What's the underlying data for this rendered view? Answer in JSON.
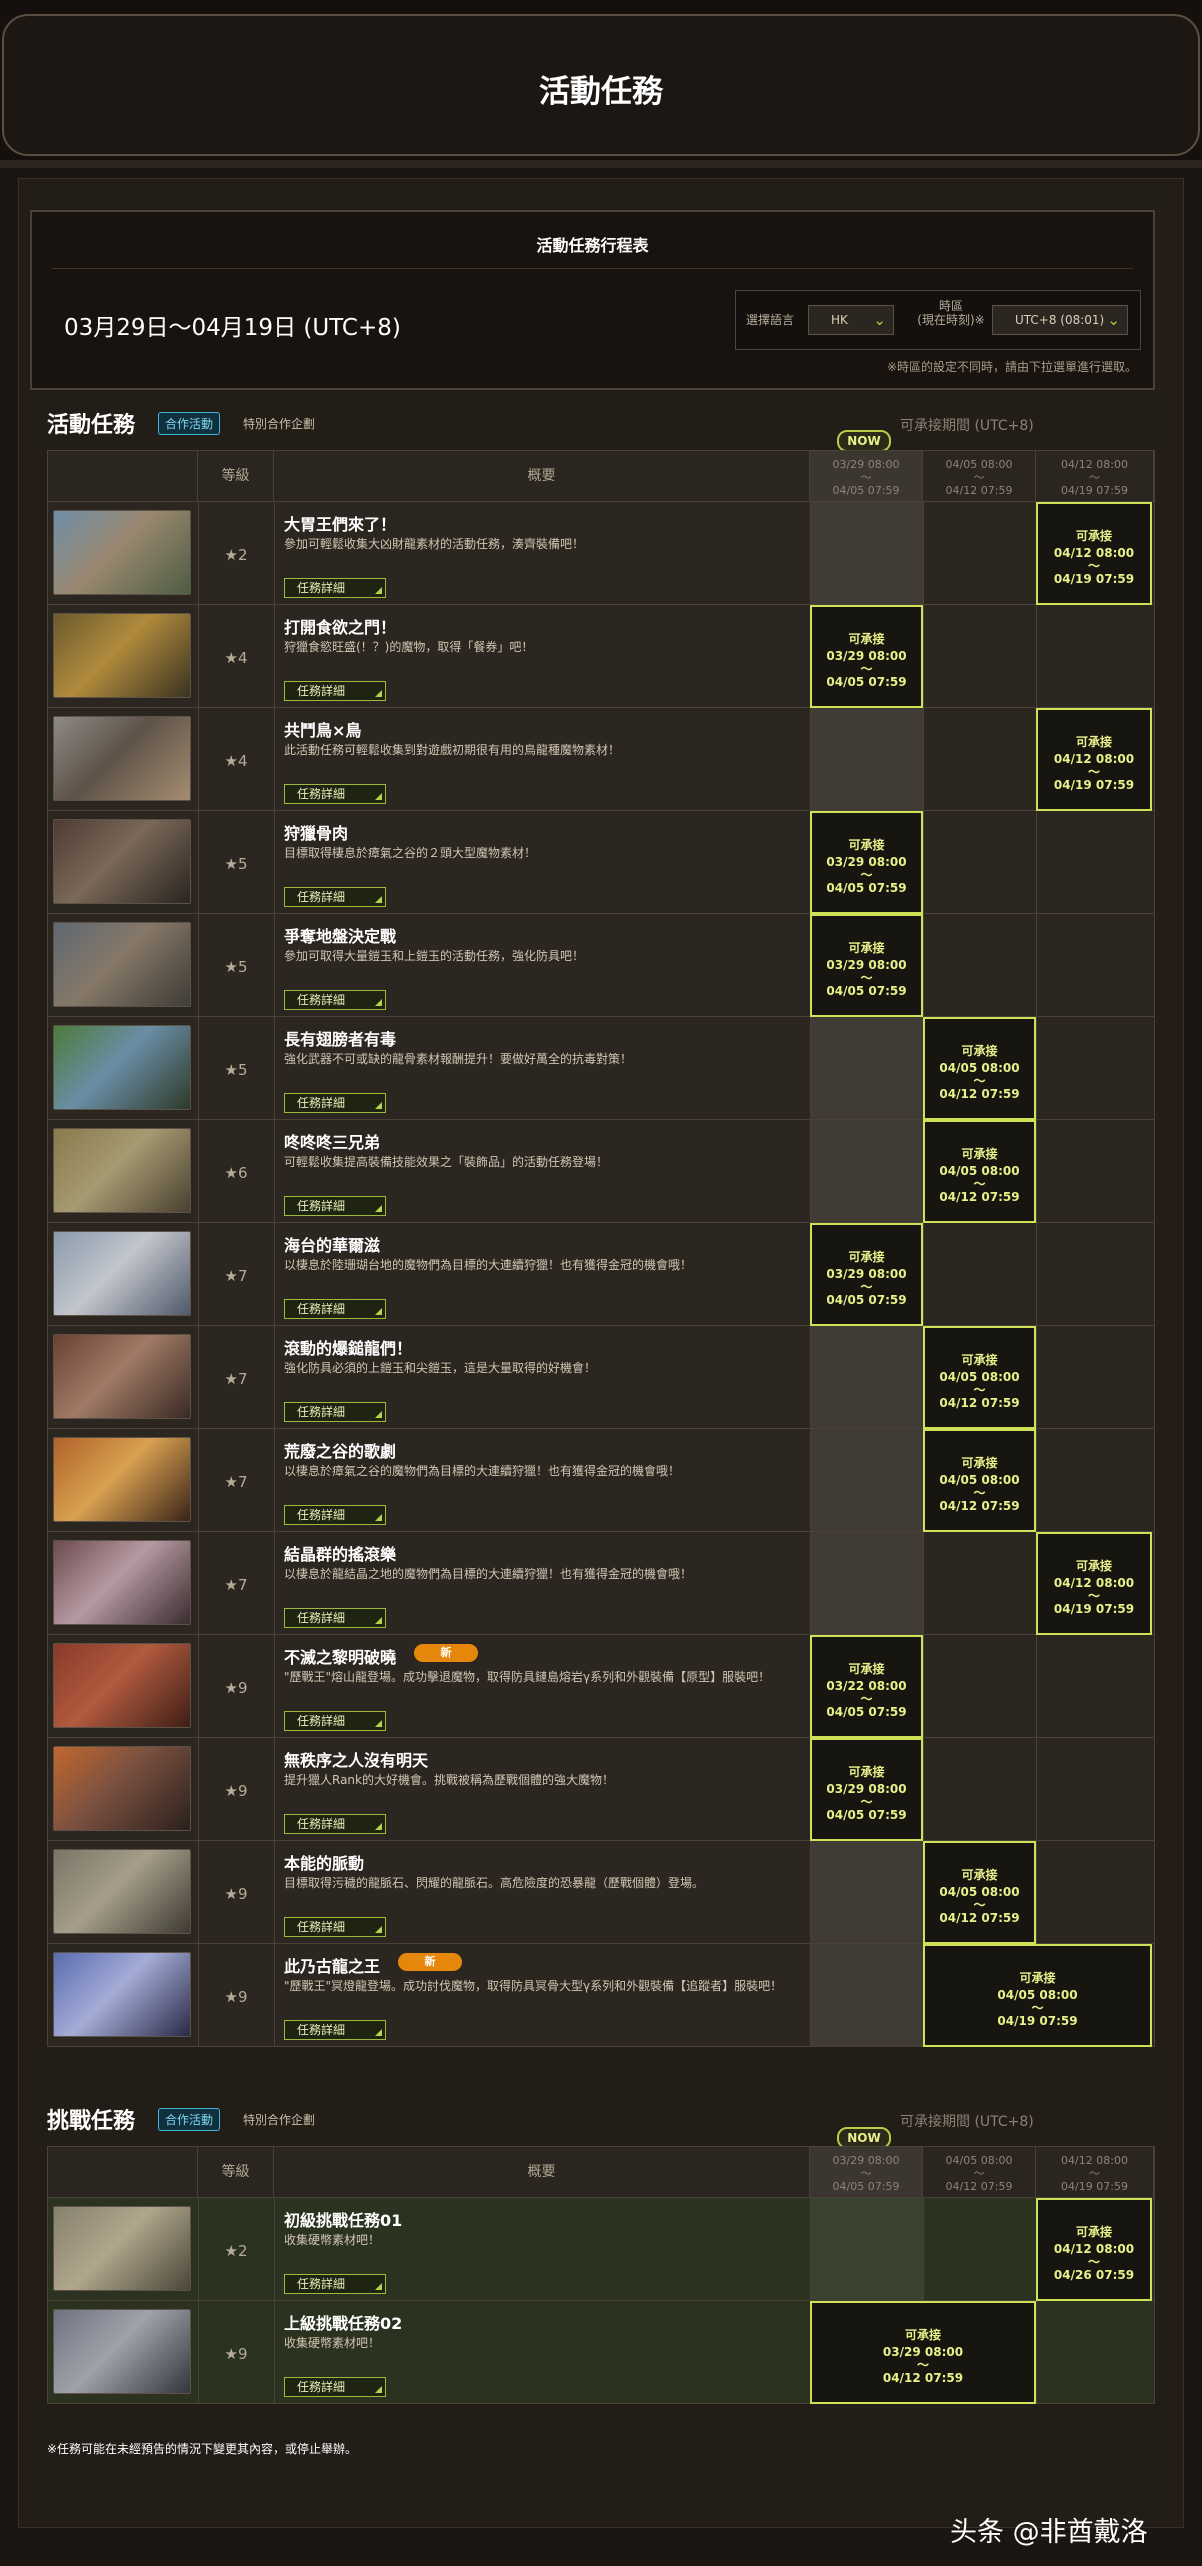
{
  "header": {
    "title": "活動任務"
  },
  "schedule": {
    "title": "活動任務行程表",
    "date_range": "03月29日～04月19日 (UTC+8)",
    "language_label": "選擇語言",
    "language_value": "HK",
    "timezone_label": "時區\n(現在時刻)※",
    "timezone_value": "UTC+8 (08:01)",
    "note": "※時區的設定不同時，請由下拉選單進行選取。"
  },
  "event_section": {
    "title": "活動任務",
    "badge": "合作活動",
    "subtitle": "特別合作企劃",
    "period_label": "可承接期間 (UTC+8)",
    "now_label": "NOW"
  },
  "challenge_section": {
    "title": "挑戰任務",
    "badge": "合作活動",
    "subtitle": "特別合作企劃",
    "period_label": "可承接期間 (UTC+8)",
    "now_label": "NOW"
  },
  "table_headers": {
    "level": "等級",
    "summary": "概要",
    "dates": [
      {
        "start": "03/29 08:00",
        "sep": "〜",
        "end": "04/05 07:59"
      },
      {
        "start": "04/05 08:00",
        "sep": "〜",
        "end": "04/12 07:59"
      },
      {
        "start": "04/12 08:00",
        "sep": "〜",
        "end": "04/19 07:59"
      }
    ]
  },
  "detail_button": "任務詳細",
  "new_badge": "新",
  "available": "可承接",
  "events": [
    {
      "title": "大胃王們來了！",
      "desc": "參加可輕鬆收集大凶財龍素材的活動任務，湊齊裝備吧！",
      "stars": "★2",
      "slot": {
        "col": 2,
        "span": 1,
        "start": "04/12 08:00",
        "sep": "〜",
        "end": "04/19 07:59"
      },
      "colors": [
        "#6f8ea8",
        "#9a8870",
        "#4e5c43"
      ]
    },
    {
      "title": "打開食欲之門！",
      "desc": "狩獵食慾旺盛(！？)的魔物，取得「餐券」吧！",
      "stars": "★4",
      "slot": {
        "col": 0,
        "span": 1,
        "start": "03/29 08:00",
        "sep": "〜",
        "end": "04/05 07:59"
      },
      "colors": [
        "#6c5a2e",
        "#b08a3c",
        "#3a3220"
      ]
    },
    {
      "title": "共鬥鳥×鳥",
      "desc": "此活動任務可輕鬆收集到對遊戲初期很有用的鳥龍種魔物素材！",
      "stars": "★4",
      "slot": {
        "col": 2,
        "span": 1,
        "start": "04/12 08:00",
        "sep": "〜",
        "end": "04/19 07:59"
      },
      "colors": [
        "#8e8a84",
        "#5e5349",
        "#a48c70"
      ]
    },
    {
      "title": "狩獵骨肉",
      "desc": "目標取得棲息於瘴氣之谷的２頭大型魔物素材！",
      "stars": "★5",
      "slot": {
        "col": 0,
        "span": 1,
        "start": "03/29 08:00",
        "sep": "〜",
        "end": "04/05 07:59"
      },
      "colors": [
        "#4e3c34",
        "#7a6858",
        "#2a2420"
      ]
    },
    {
      "title": "爭奪地盤決定戰",
      "desc": "參加可取得大量鎧玉和上鎧玉的活動任務，強化防具吧！",
      "stars": "★5",
      "slot": {
        "col": 0,
        "span": 1,
        "start": "03/29 08:00",
        "sep": "〜",
        "end": "04/05 07:59"
      },
      "colors": [
        "#5e6872",
        "#867868",
        "#3e3c36"
      ]
    },
    {
      "title": "長有翅膀者有毒",
      "desc": "強化武器不可或缺的龍骨素材報酬提升！要做好萬全的抗毒對策！",
      "stars": "★5",
      "slot": {
        "col": 1,
        "span": 1,
        "start": "04/05 08:00",
        "sep": "〜",
        "end": "04/12 07:59"
      },
      "colors": [
        "#4d7a3a",
        "#6a8ea6",
        "#2e3a28"
      ]
    },
    {
      "title": "咚咚咚三兄弟",
      "desc": "可輕鬆收集提高裝備技能效果之「裝飾品」的活動任務登場！",
      "stars": "★6",
      "slot": {
        "col": 1,
        "span": 1,
        "start": "04/05 08:00",
        "sep": "〜",
        "end": "04/12 07:59"
      },
      "colors": [
        "#8a7a4c",
        "#a69a72",
        "#4a4030"
      ]
    },
    {
      "title": "海台的華爾滋",
      "desc": "以棲息於陸珊瑚台地的魔物們為目標的大連續狩獵！也有獲得金冠的機會哦！",
      "stars": "★7",
      "slot": {
        "col": 0,
        "span": 1,
        "start": "03/29 08:00",
        "sep": "〜",
        "end": "04/05 07:59"
      },
      "colors": [
        "#8a9aac",
        "#c2c6cc",
        "#50586a"
      ]
    },
    {
      "title": "滾動的爆鎚龍們！",
      "desc": "強化防具必須的上鎧玉和尖鎧玉，這是大量取得的好機會！",
      "stars": "★7",
      "slot": {
        "col": 1,
        "span": 1,
        "start": "04/05 08:00",
        "sep": "〜",
        "end": "04/12 07:59"
      },
      "colors": [
        "#6a4034",
        "#a07a66",
        "#3a2a24"
      ]
    },
    {
      "title": "荒廢之谷的歌劇",
      "desc": "以棲息於瘴氣之谷的魔物們為目標的大連續狩獵！也有獲得金冠的機會哦！",
      "stars": "★7",
      "slot": {
        "col": 1,
        "span": 1,
        "start": "04/05 08:00",
        "sep": "〜",
        "end": "04/12 07:59"
      },
      "colors": [
        "#b0622a",
        "#d8a050",
        "#3a2418"
      ]
    },
    {
      "title": "結晶群的搖滾樂",
      "desc": "以棲息於龍結晶之地的魔物們為目標的大連續狩獵！也有獲得金冠的機會哦！",
      "stars": "★7",
      "slot": {
        "col": 2,
        "span": 1,
        "start": "04/12 08:00",
        "sep": "〜",
        "end": "04/19 07:59"
      },
      "colors": [
        "#6c4a4e",
        "#b69aa2",
        "#3a2c30"
      ]
    },
    {
      "title": "不滅之黎明破曉",
      "desc": "\"歷戰王\"熔山龍登場。成功擊退魔物，取得防具鏈島熔岩γ系列和外觀裝備【原型】服裝吧！",
      "stars": "★9",
      "isNew": true,
      "slot": {
        "col": 0,
        "span": 1,
        "start": "03/22 08:00",
        "sep": "〜",
        "end": "04/05 07:59"
      },
      "colors": [
        "#8a3a2a",
        "#b05a3e",
        "#3e1e16"
      ]
    },
    {
      "title": "無秩序之人沒有明天",
      "desc": "提升獵人Rank的大好機會。挑戰被稱為歷戰個體的強大魔物！",
      "stars": "★9",
      "slot": {
        "col": 0,
        "span": 1,
        "start": "03/29 08:00",
        "sep": "〜",
        "end": "04/05 07:59"
      },
      "colors": [
        "#c0682e",
        "#7a5040",
        "#2a201c"
      ]
    },
    {
      "title": "本能的脈動",
      "desc": "目標取得污穢的龍脈石、閃耀的龍脈石。高危險度的恐暴龍（歷戰個體）登場。",
      "stars": "★9",
      "slot": {
        "col": 1,
        "span": 1,
        "start": "04/05 08:00",
        "sep": "〜",
        "end": "04/12 07:59"
      },
      "colors": [
        "#7a7466",
        "#a69e8a",
        "#3e3a32"
      ]
    },
    {
      "title": "此乃古龍之王",
      "desc": "\"歷戰王\"冥燈龍登場。成功討伐魔物，取得防具冥骨大型γ系列和外觀裝備【追蹤者】服裝吧！",
      "stars": "★9",
      "isNew": true,
      "slot": {
        "col": 1,
        "span": 2,
        "start": "04/05 08:00",
        "sep": "〜",
        "end": "04/19 07:59"
      },
      "colors": [
        "#5a6cb0",
        "#a4acd6",
        "#2a2a48"
      ]
    }
  ],
  "challenges": [
    {
      "title": "初級挑戰任務01",
      "desc": "收集硬幣素材吧！",
      "stars": "★2",
      "slot": {
        "col": 2,
        "span": 1,
        "start": "04/12 08:00",
        "sep": "〜",
        "end": "04/26 07:59"
      },
      "colors": [
        "#86806e",
        "#b0a68c",
        "#4a4638"
      ]
    },
    {
      "title": "上級挑戰任務02",
      "desc": "收集硬幣素材吧！",
      "stars": "★9",
      "slot": {
        "col": 0,
        "span": 2,
        "start": "03/29 08:00",
        "sep": "〜",
        "end": "04/12 07:59"
      },
      "colors": [
        "#6e7280",
        "#a0a2aa",
        "#34363e"
      ]
    }
  ],
  "footer_note": "※任務可能在未經預告的情況下變更其內容，或停止舉辦。",
  "watermark": "头条 @非酋戴洛"
}
